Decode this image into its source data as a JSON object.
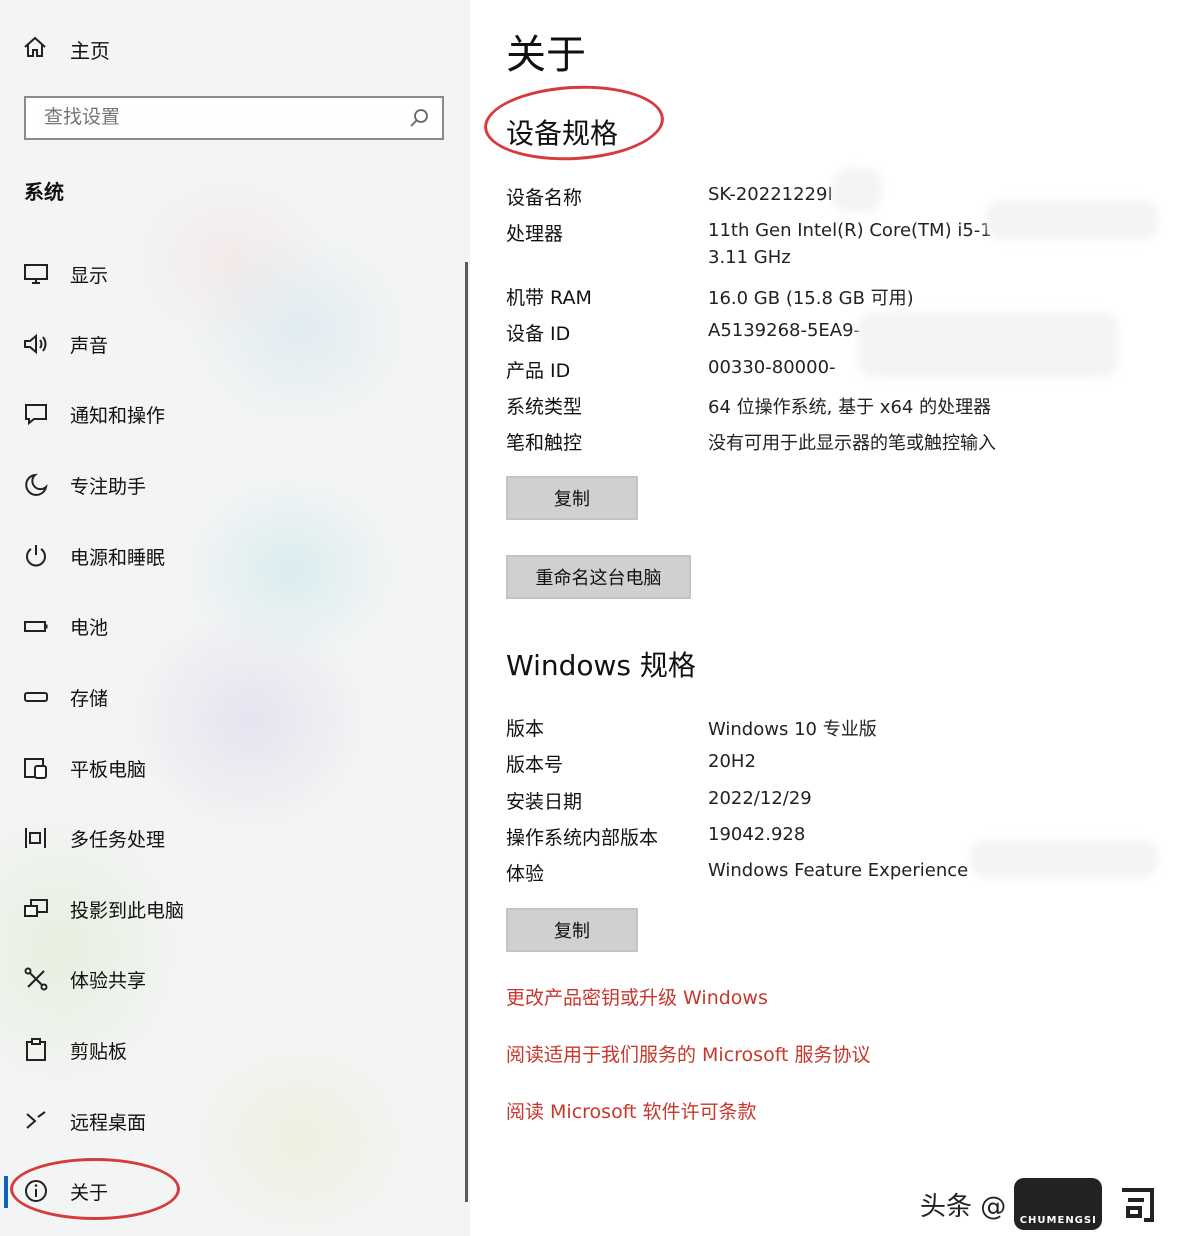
{
  "sidebar": {
    "home_label": "主页",
    "search_placeholder": "查找设置",
    "section_title": "系统",
    "items": [
      {
        "label": "显示",
        "icon": "monitor-icon"
      },
      {
        "label": "声音",
        "icon": "speaker-icon"
      },
      {
        "label": "通知和操作",
        "icon": "notification-icon"
      },
      {
        "label": "专注助手",
        "icon": "moon-icon"
      },
      {
        "label": "电源和睡眠",
        "icon": "power-icon"
      },
      {
        "label": "电池",
        "icon": "battery-icon"
      },
      {
        "label": "存储",
        "icon": "storage-icon"
      },
      {
        "label": "平板电脑",
        "icon": "tablet-icon"
      },
      {
        "label": "多任务处理",
        "icon": "multitask-icon"
      },
      {
        "label": "投影到此电脑",
        "icon": "project-icon"
      },
      {
        "label": "体验共享",
        "icon": "share-icon"
      },
      {
        "label": "剪贴板",
        "icon": "clipboard-icon"
      },
      {
        "label": "远程桌面",
        "icon": "remote-icon"
      },
      {
        "label": "关于",
        "icon": "info-icon"
      }
    ]
  },
  "main": {
    "title": "关于",
    "device_section": "设备规格",
    "device_specs": [
      {
        "label": "设备名称",
        "value": "SK-20221229I"
      },
      {
        "label": "处理器",
        "value": "11th Gen Intel(R) Core(TM) i5-1",
        "value2": "3.11 GHz"
      },
      {
        "label": "机带 RAM",
        "value": "16.0 GB (15.8 GB 可用)"
      },
      {
        "label": "设备 ID",
        "value": "A5139268-5EA9-"
      },
      {
        "label": "产品 ID",
        "value": "00330-80000-"
      },
      {
        "label": "系统类型",
        "value": "64 位操作系统, 基于 x64 的处理器"
      },
      {
        "label": "笔和触控",
        "value": "没有可用于此显示器的笔或触控输入"
      }
    ],
    "copy_label": "复制",
    "rename_label": "重命名这台电脑",
    "windows_section": "Windows 规格",
    "windows_specs": [
      {
        "label": "版本",
        "value": "Windows 10 专业版"
      },
      {
        "label": "版本号",
        "value": "20H2"
      },
      {
        "label": "安装日期",
        "value": "2022/12/29"
      },
      {
        "label": "操作系统内部版本",
        "value": "19042.928"
      },
      {
        "label": "体验",
        "value": "Windows Feature Experience"
      }
    ],
    "copy2_label": "复制",
    "links": [
      "更改产品密钥或升级 Windows",
      "阅读适用于我们服务的 Microsoft 服务协议",
      "阅读 Microsoft 软件许可条款"
    ]
  },
  "watermark": {
    "text": "头条 @",
    "logo_text": "CHUMENGSI"
  },
  "colors": {
    "accent_red": "#c8372c",
    "annotation_red": "#d63a3a",
    "active_blue": "#0b64c0"
  }
}
